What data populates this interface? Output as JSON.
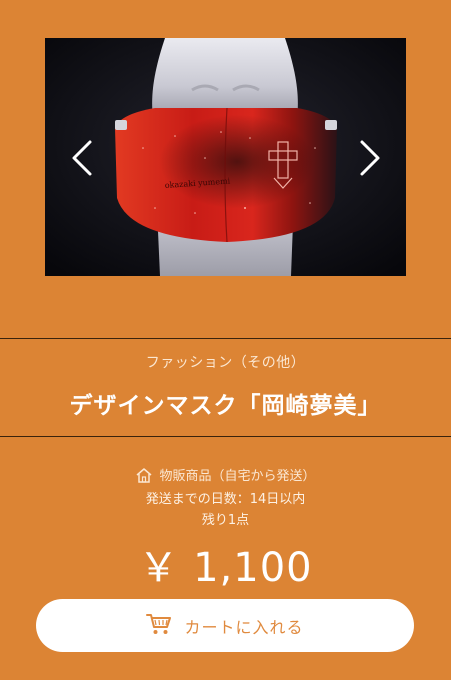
{
  "product": {
    "category": "ファッション（その他）",
    "title": "デザインマスク「岡崎夢美」",
    "image_alt": "デザインマスク「岡崎夢美」",
    "mask_print": "okazaki yumemi"
  },
  "shipping": {
    "type_label": "物販商品（自宅から発送）",
    "days_label": "発送までの日数：14日以内",
    "stock_label": "残り1点"
  },
  "price": "￥ 1,100",
  "cart_button": {
    "label": "カートに入れる"
  },
  "icons": {
    "prev": "chevron-left-icon",
    "next": "chevron-right-icon",
    "home": "home-icon",
    "cart": "cart-icon"
  },
  "colors": {
    "background": "#dc8434",
    "button_text": "#e08a3e",
    "mask_red": "#d5201a"
  }
}
